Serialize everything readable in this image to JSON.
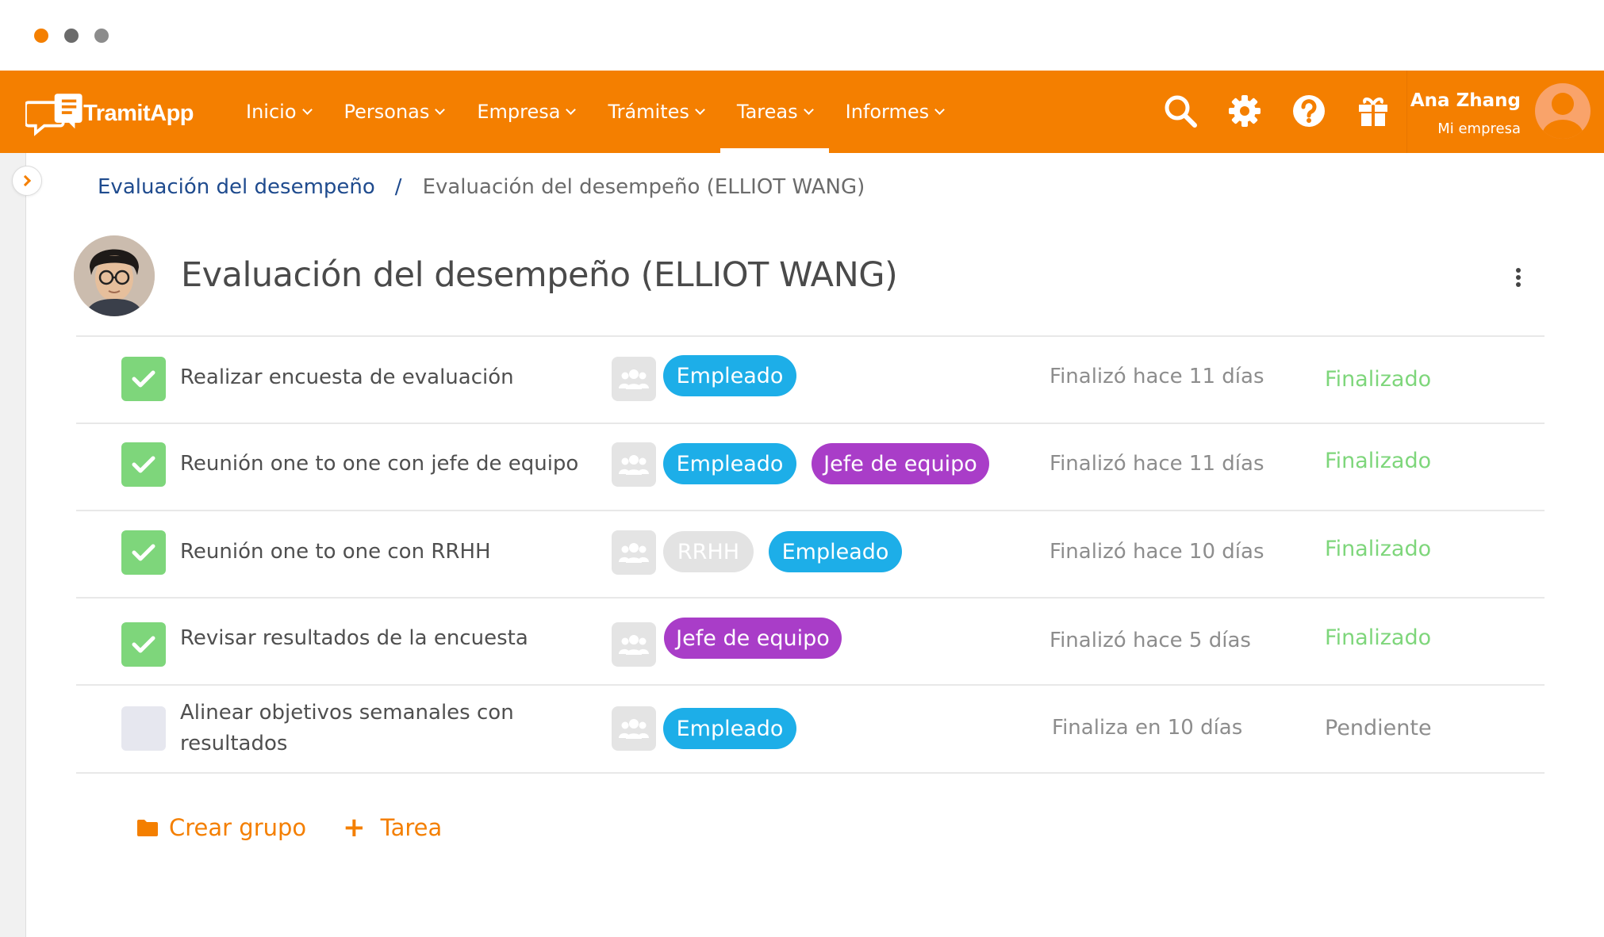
{
  "app": {
    "logo_text": "TramitApp",
    "brand_color": "#f47f00"
  },
  "nav": {
    "items": [
      {
        "label": "Inicio",
        "active": false
      },
      {
        "label": "Personas",
        "active": false
      },
      {
        "label": "Empresa",
        "active": false
      },
      {
        "label": "Trámites",
        "active": false
      },
      {
        "label": "Tareas",
        "active": true
      },
      {
        "label": "Informes",
        "active": false
      }
    ],
    "icons": [
      "search-icon",
      "gear-icon",
      "help-icon",
      "gift-icon"
    ]
  },
  "user": {
    "name": "Ana Zhang",
    "company": "Mi empresa"
  },
  "breadcrumb": {
    "parent": "Evaluación del desempeño",
    "separator": "/",
    "current": "Evaluación del desempeño (ELLIOT WANG)"
  },
  "header": {
    "title": "Evaluación del desempeño (ELLIOT WANG)"
  },
  "tasks": [
    {
      "name": "Realizar encuesta de evaluación",
      "done": true,
      "assignees": [
        "Empleado"
      ],
      "due": "Finalizó hace 11 días",
      "status": "Finalizado"
    },
    {
      "name": "Reunión one to one con jefe de equipo",
      "done": true,
      "assignees": [
        "Empleado",
        "Jefe de equipo"
      ],
      "due": "Finalizó hace 11 días",
      "status": "Finalizado"
    },
    {
      "name": "Reunión one to one con RRHH",
      "done": true,
      "assignees": [
        "RRHH",
        "Empleado"
      ],
      "due": "Finalizó hace 10 días",
      "status": "Finalizado"
    },
    {
      "name": "Revisar resultados de la encuesta",
      "done": true,
      "assignees": [
        "Jefe de equipo"
      ],
      "due": "Finalizó hace 5 días",
      "status": "Finalizado"
    },
    {
      "name": "Alinear objetivos semanales con resultados",
      "done": false,
      "assignees": [
        "Empleado"
      ],
      "due": "Finaliza en 10 días",
      "status": "Pendiente"
    }
  ],
  "actions": {
    "create_group": "Crear grupo",
    "add_task": "Tarea"
  },
  "colors": {
    "employee_chip": "#1daee8",
    "manager_chip": "#a93dc8",
    "hr_chip": "#e3e3e3",
    "done_status": "#7ed67b"
  }
}
